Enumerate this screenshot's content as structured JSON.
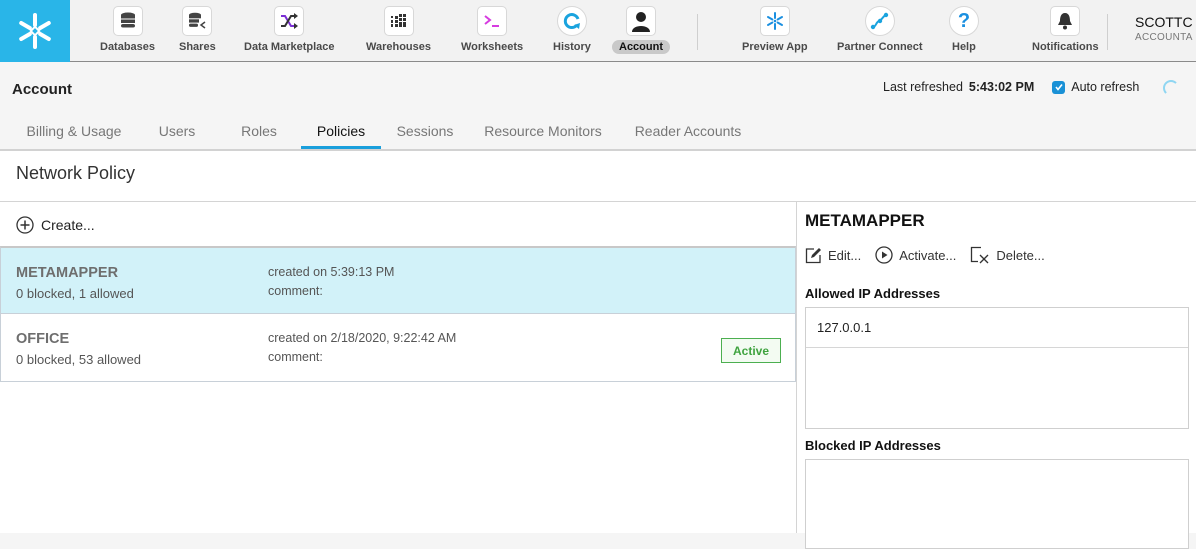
{
  "nav": {
    "logo": "snowflake-logo",
    "items": [
      {
        "label": "Databases",
        "icon": "database-icon"
      },
      {
        "label": "Shares",
        "icon": "share-icon"
      },
      {
        "label": "Data Marketplace",
        "icon": "shuffle-icon"
      },
      {
        "label": "Warehouses",
        "icon": "warehouse-grid-icon"
      },
      {
        "label": "Worksheets",
        "icon": "terminal-icon"
      },
      {
        "label": "History",
        "icon": "history-icon"
      },
      {
        "label": "Account",
        "icon": "user-silhouette-icon",
        "active": true
      }
    ],
    "right_items": [
      {
        "label": "Preview App",
        "icon": "snowflake-icon"
      },
      {
        "label": "Partner Connect",
        "icon": "connect-icon"
      },
      {
        "label": "Help",
        "icon": "question-icon"
      },
      {
        "label": "Notifications",
        "icon": "bell-icon"
      }
    ],
    "user": {
      "name": "SCOTTC",
      "account": "ACCOUNTA"
    }
  },
  "header": {
    "title": "Account",
    "last_refreshed_label": "Last refreshed",
    "last_refreshed_time": "5:43:02 PM",
    "auto_refresh_label": "Auto refresh",
    "auto_refresh_checked": true
  },
  "tabs": [
    {
      "label": "Billing & Usage"
    },
    {
      "label": "Users"
    },
    {
      "label": "Roles"
    },
    {
      "label": "Policies",
      "active": true
    },
    {
      "label": "Sessions"
    },
    {
      "label": "Resource Monitors"
    },
    {
      "label": "Reader Accounts"
    }
  ],
  "section": {
    "title": "Network Policy"
  },
  "list": {
    "create_label": "Create...",
    "policies": [
      {
        "name": "METAMAPPER",
        "counts": "0 blocked, 1 allowed",
        "created": "created on 5:39:13 PM",
        "comment": "comment:",
        "selected": true
      },
      {
        "name": "OFFICE",
        "counts": "0 blocked, 53 allowed",
        "created": "created on 2/18/2020, 9:22:42 AM",
        "comment": "comment:",
        "badge": "Active"
      }
    ]
  },
  "detail": {
    "title": "METAMAPPER",
    "actions": {
      "edit": "Edit...",
      "activate": "Activate...",
      "delete": "Delete..."
    },
    "allowed_label": "Allowed IP Addresses",
    "allowed_ips": [
      "127.0.0.1"
    ],
    "blocked_label": "Blocked IP Addresses",
    "blocked_ips": []
  },
  "colors": {
    "brand": "#29b5e8",
    "selected_row": "#d2f2f9",
    "active_tab": "#1a9fdc",
    "active_badge": "#4caf50"
  }
}
